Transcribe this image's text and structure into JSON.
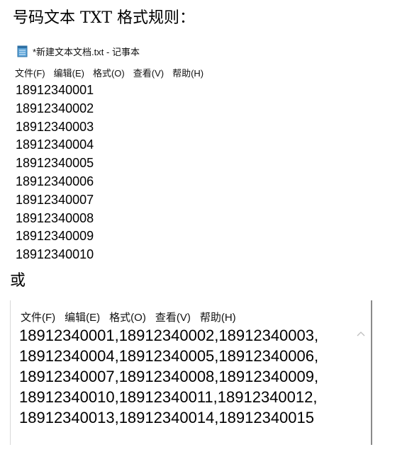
{
  "heading": "号码文本 TXT 格式规则：",
  "or_label": "或",
  "window1": {
    "title": "*新建文本文档.txt - 记事本",
    "icon": "notepad-icon",
    "menu": [
      "文件(F)",
      "编辑(E)",
      "格式(O)",
      "查看(V)",
      "帮助(H)"
    ],
    "lines": [
      "18912340001",
      "18912340002",
      "18912340003",
      "18912340004",
      "18912340005",
      "18912340006",
      "18912340007",
      "18912340008",
      "18912340009",
      "18912340010"
    ]
  },
  "window2": {
    "menu": [
      "文件(F)",
      "编辑(E)",
      "格式(O)",
      "查看(V)",
      "帮助(H)"
    ],
    "lines": [
      "18912340001,18912340002,18912340003,",
      "18912340004,18912340005,18912340006,",
      "18912340007,18912340008,18912340009,",
      "18912340010,18912340011,18912340012,",
      "18912340013,18912340014,18912340015"
    ],
    "scroll_icon": "chevron-up-icon"
  },
  "colors": {
    "icon_blue": "#5aa3d8",
    "scroll_arrow": "#bdbdbd",
    "window_border": "#8a8a8a"
  }
}
